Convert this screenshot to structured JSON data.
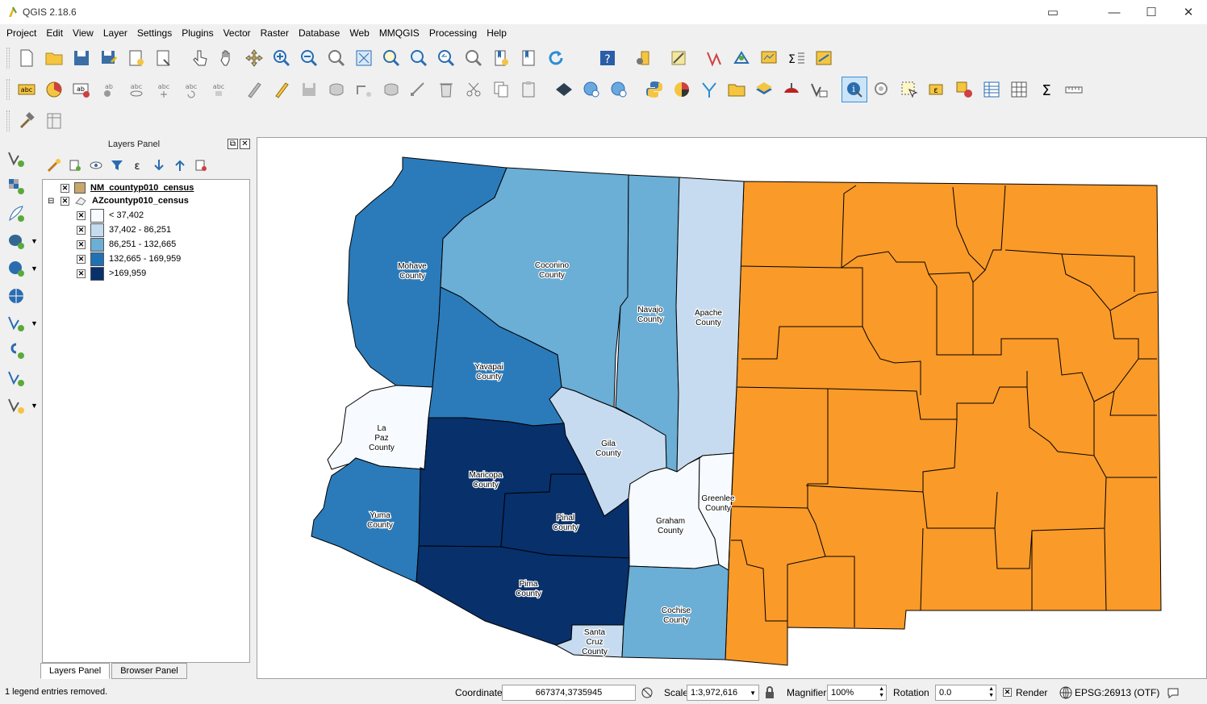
{
  "window": {
    "title": "QGIS 2.18.6",
    "minimize": "—",
    "maximize": "☐",
    "close": "✕"
  },
  "menu": [
    "Project",
    "Edit",
    "View",
    "Layer",
    "Settings",
    "Plugins",
    "Vector",
    "Raster",
    "Database",
    "Web",
    "MMQGIS",
    "Processing",
    "Help"
  ],
  "layers_panel": {
    "title": "Layers Panel",
    "layers": [
      {
        "name": "NM_countyp010_census",
        "checked": true,
        "color": "#c9a66b"
      },
      {
        "name": "AZcountyp010_census",
        "checked": true
      }
    ],
    "legend": [
      {
        "label": "< 37,402",
        "color": "#f7fbff"
      },
      {
        "label": "37,402 - 86,251",
        "color": "#c6dbef"
      },
      {
        "label": "86,251 - 132,665",
        "color": "#6baed6"
      },
      {
        "label": "132,665 - 169,959",
        "color": "#2171b5"
      },
      {
        "label": ">169,959",
        "color": "#08306b"
      }
    ]
  },
  "tabs": {
    "layers": "Layers Panel",
    "browser": "Browser Panel"
  },
  "map": {
    "nm_color": "#fa9a28",
    "az_counties": [
      {
        "name": "Mohave\nCounty"
      },
      {
        "name": "Coconino\nCounty"
      },
      {
        "name": "Navajo\nCounty"
      },
      {
        "name": "Apache\nCounty"
      },
      {
        "name": "Yavapai\nCounty"
      },
      {
        "name": "La\nPaz\nCounty"
      },
      {
        "name": "Gila\nCounty"
      },
      {
        "name": "Maricopa\nCounty"
      },
      {
        "name": "Yuma\nCounty"
      },
      {
        "name": "Pinal\nCounty"
      },
      {
        "name": "Greenlee\nCounty"
      },
      {
        "name": "Graham\nCounty"
      },
      {
        "name": "Pima\nCounty"
      },
      {
        "name": "Cochise\nCounty"
      },
      {
        "name": "Santa\nCruz\nCounty"
      }
    ]
  },
  "status": {
    "message": "1 legend entries removed.",
    "coordinate_label": "Coordinate",
    "coordinate": "667374,3735945",
    "scale_label": "Scale",
    "scale": "1:3,972,616",
    "magnifier_label": "Magnifier",
    "magnifier": "100%",
    "rotation_label": "Rotation",
    "rotation": "0.0",
    "render_label": "Render",
    "crs": "EPSG:26913 (OTF)"
  }
}
